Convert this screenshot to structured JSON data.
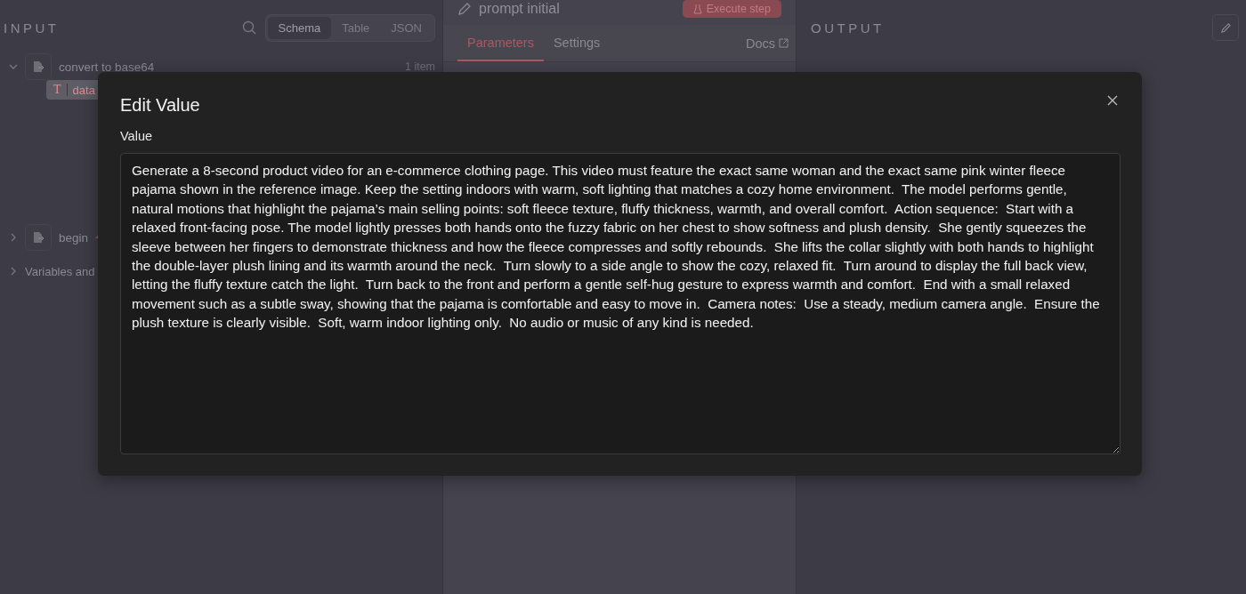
{
  "input_panel": {
    "title": "INPUT",
    "view_tabs": [
      {
        "label": "Schema",
        "selected": true
      },
      {
        "label": "Table",
        "selected": false
      },
      {
        "label": "JSON",
        "selected": false
      }
    ],
    "nodes": [
      {
        "name": "convert to base64",
        "count": "1 item",
        "expanded": true,
        "fields": [
          {
            "type_glyph": "T",
            "name": "data"
          }
        ]
      },
      {
        "name": "begin",
        "expanded": false
      }
    ],
    "variables": "Variables and"
  },
  "node_panel": {
    "title": "prompt initial",
    "execute_button": "Execute step",
    "tabs": [
      {
        "label": "Parameters",
        "selected": true
      },
      {
        "label": "Settings",
        "selected": false
      }
    ],
    "docs_link": "Docs"
  },
  "output_panel": {
    "title": "OUTPUT"
  },
  "dialog": {
    "title": "Edit Value",
    "field_label": "Value",
    "value": "Generate a 8-second product video for an e-commerce clothing page. This video must feature the exact same woman and the exact same pink winter fleece pajama shown in the reference image. Keep the setting indoors with warm, soft lighting that matches a cozy home environment.  The model performs gentle, natural motions that highlight the pajama’s main selling points: soft fleece texture, fluffy thickness, warmth, and overall comfort.  Action sequence:  Start with a relaxed front-facing pose. The model lightly presses both hands onto the fuzzy fabric on her chest to show softness and plush density.  She gently squeezes the sleeve between her fingers to demonstrate thickness and how the fleece compresses and softly rebounds.  She lifts the collar slightly with both hands to highlight the double-layer plush lining and its warmth around the neck.  Turn slowly to a side angle to show the cozy, relaxed fit.  Turn around to display the full back view, letting the fluffy texture catch the light.  Turn back to the front and perform a gentle self-hug gesture to express warmth and comfort.  End with a small relaxed movement such as a subtle sway, showing that the pajama is comfortable and easy to move in.  Camera notes:  Use a steady, medium camera angle.  Ensure the plush texture is clearly visible.  Soft, warm indoor lighting only.  No audio or music of any kind is needed."
  }
}
